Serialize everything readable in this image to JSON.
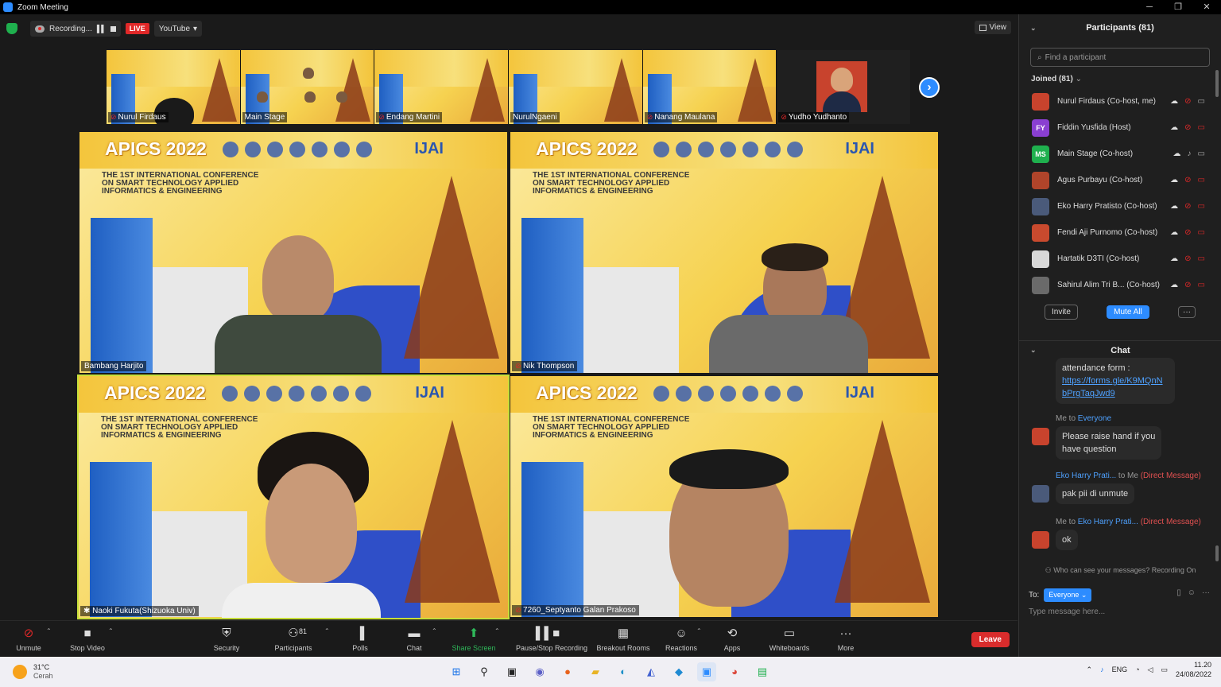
{
  "window": {
    "title": "Zoom Meeting"
  },
  "status": {
    "recording_label": "Recording...",
    "live_label": "LIVE",
    "stream_label": "YouTube",
    "view_label": "View"
  },
  "thumbnails": [
    {
      "name": "Nurul Firdaus"
    },
    {
      "name": "Main Stage"
    },
    {
      "name": "Endang Martini"
    },
    {
      "name": "NurulNgaeni"
    },
    {
      "name": "Nanang Maulana"
    },
    {
      "name": "Yudho Yudhanto"
    }
  ],
  "tiles": [
    {
      "name": "Bambang Harjito"
    },
    {
      "name": "Nik Thompson"
    },
    {
      "name": "Naoki Fukuta(Shizuoka Univ)"
    },
    {
      "name": "7260_Septyanto Galan Prakoso"
    }
  ],
  "slide": {
    "brand": "APICS 2022",
    "journal": "IJAI",
    "line1": "The 1st International Conference",
    "line2": "On Smart Technology Applied",
    "line3": "Informatics & Engineering"
  },
  "participants": {
    "title": "Participants (81)",
    "search_placeholder": "Find a participant",
    "joined_label": "Joined (81)",
    "list": [
      {
        "name": "Nurul Firdaus (Co-host, me)",
        "initials": "",
        "color": "#c8432d"
      },
      {
        "name": "Fiddin Yusfida (Host)",
        "initials": "FY",
        "color": "#8a3fd1"
      },
      {
        "name": "Main Stage (Co-host)",
        "initials": "MS",
        "color": "#1fb04e"
      },
      {
        "name": "Agus Purbayu (Co-host)",
        "initials": "",
        "color": "#b0442a"
      },
      {
        "name": "Eko Harry Pratisto (Co-host)",
        "initials": "",
        "color": "#4a5a7a"
      },
      {
        "name": "Fendi Aji Purnomo (Co-host)",
        "initials": "",
        "color": "#c94a2e"
      },
      {
        "name": "Hartatik D3TI (Co-host)",
        "initials": "",
        "color": "#d8d8d8"
      },
      {
        "name": "Sahirul Alim Tri B... (Co-host)",
        "initials": "",
        "color": "#6a6a6a"
      }
    ],
    "invite_label": "Invite",
    "mute_all_label": "Mute All",
    "more_label": "···"
  },
  "chat": {
    "title": "Chat",
    "msg1_prefix": "attendance form :",
    "msg1_link1": "https://forms.gle/K9MQnN",
    "msg1_link2": "bPrgTaqJwd9",
    "msg2_from": "Me to ",
    "msg2_to": "Everyone",
    "msg2_text1": "Please raise hand if you",
    "msg2_text2": "have question",
    "msg3_from": "Eko Harry Prati...",
    "msg3_mid": " to Me ",
    "msg3_tag": "(Direct Message)",
    "msg3_text": "pak pii di unmute",
    "msg4_from": "Me to ",
    "msg4_to": "Eko Harry Prati...",
    "msg4_tag": " (Direct Message)",
    "msg4_text": "ok",
    "who_can_see": "Who can see your messages? Recording On",
    "to_label": "To:",
    "to_value": "Everyone",
    "input_placeholder": "Type message here..."
  },
  "toolbar": {
    "unmute": "Unmute",
    "stop_video": "Stop Video",
    "security": "Security",
    "participants": "Participants",
    "participants_count": "81",
    "polls": "Polls",
    "chat": "Chat",
    "share_screen": "Share Screen",
    "pause_stop_recording": "Pause/Stop Recording",
    "breakout_rooms": "Breakout Rooms",
    "reactions": "Reactions",
    "apps": "Apps",
    "whiteboards": "Whiteboards",
    "more": "More",
    "leave": "Leave"
  },
  "taskbar": {
    "temp": "31°C",
    "weather": "Cerah",
    "lang": "ENG",
    "time": "11.20",
    "date": "24/08/2022"
  }
}
